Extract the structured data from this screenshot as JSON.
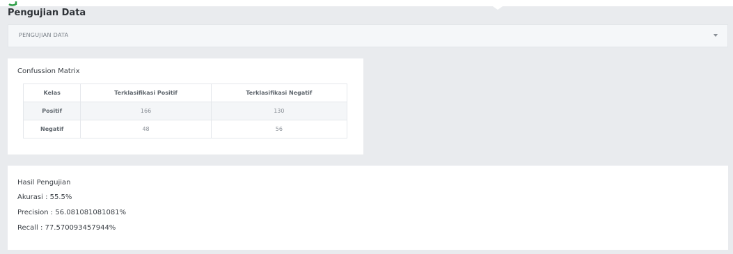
{
  "page": {
    "title": "Pengujian Data"
  },
  "dropdown": {
    "selected": "PENGUJIAN DATA"
  },
  "matrix": {
    "title": "Confussion Matrix",
    "headers": [
      "Kelas",
      "Terklasifikasi Positif",
      "Terklasifikasi Negatif"
    ],
    "rows": [
      {
        "kelas": "Positif",
        "positif": "166",
        "negatif": "130"
      },
      {
        "kelas": "Negatif",
        "positif": "48",
        "negatif": "56"
      }
    ]
  },
  "result": {
    "title": "Hasil Pengujian",
    "akurasi": "Akurasi : 55.5%",
    "precision": "Precision : 56.081081081081%",
    "recall": "Recall : 77.570093457944%"
  },
  "colors": {
    "background": "#e9ebee",
    "card": "#ffffff",
    "logo_green": "#2e9e47"
  },
  "icons": {
    "logo": "app-logo-icon",
    "dropdown_caret": "caret-down-icon"
  }
}
